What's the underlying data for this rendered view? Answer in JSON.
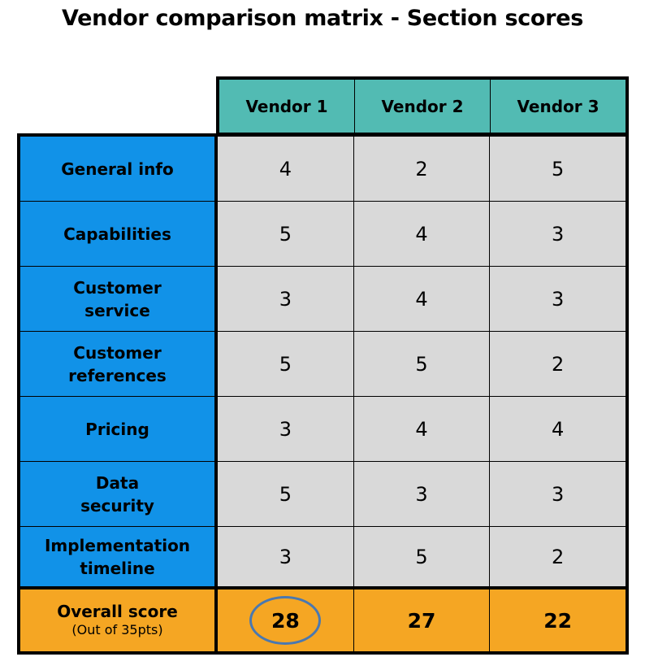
{
  "title": "Vendor comparison matrix - Section scores",
  "vendors": [
    "Vendor 1",
    "Vendor 2",
    "Vendor 3"
  ],
  "sections": [
    {
      "label": "General info",
      "scores": [
        "4",
        "2",
        "5"
      ]
    },
    {
      "label": "Capabilities",
      "scores": [
        "5",
        "4",
        "3"
      ]
    },
    {
      "label": "Customer service",
      "scores": [
        "3",
        "4",
        "3"
      ]
    },
    {
      "label": "Customer references",
      "scores": [
        "5",
        "5",
        "2"
      ]
    },
    {
      "label": "Pricing",
      "scores": [
        "3",
        "4",
        "4"
      ]
    },
    {
      "label": "Data security",
      "scores": [
        "5",
        "3",
        "3"
      ]
    },
    {
      "label": "Implementation timeline",
      "scores": [
        "3",
        "5",
        "2"
      ]
    }
  ],
  "overall": {
    "label": "Overall score",
    "sublabel": "(Out of 35pts)",
    "scores": [
      "28",
      "27",
      "22"
    ],
    "highlighted_vendor_index": 0
  },
  "colors": {
    "header": "#52bbb3",
    "row_label": "#1192e8",
    "cell": "#d9d9d9",
    "overall": "#f5a623",
    "highlight_circle": "#4a78b0"
  }
}
